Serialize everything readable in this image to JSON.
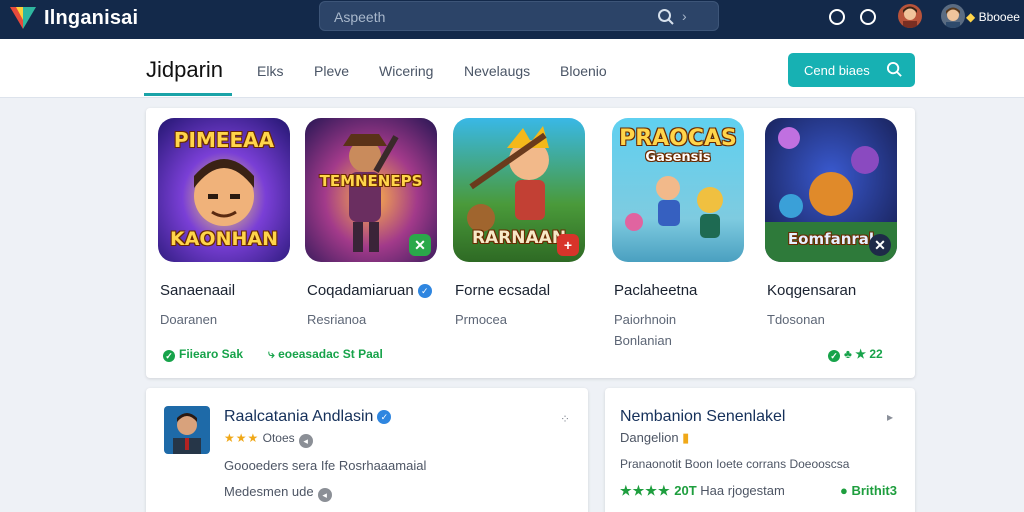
{
  "topbar": {
    "brand": "Ilnganisai",
    "search_placeholder": "Aspeeth",
    "search_chevron": "›",
    "badge_text": "Bbooee",
    "badge_icon": "◆"
  },
  "nav": {
    "title": "Jidparin",
    "tabs": [
      "Elks",
      "Pleve",
      "Wicering",
      "Nevelaugs",
      "Bloenio"
    ],
    "cta_label": "Cend biaes"
  },
  "games": [
    {
      "art_text": "PIMEEAA",
      "art_text2": "KAONHAN",
      "title": "Sanaenaail",
      "sub": "Doaranen",
      "sub2": "",
      "verified": false,
      "corner": ""
    },
    {
      "art_text": "TEMNENEPS",
      "art_text2": "",
      "title": "Coqadamiaruan",
      "sub": "Resrianoa",
      "sub2": "",
      "verified": true,
      "corner": "✕"
    },
    {
      "art_text": "RARNAAN",
      "art_text2": "",
      "title": "Forne ecsadal",
      "sub": "Prmocea",
      "sub2": "",
      "verified": false,
      "corner": "+"
    },
    {
      "art_text": "PRAOCAS",
      "art_text2": "Gasensis",
      "title": "Paclaheetna",
      "sub": "Paiorhnoin",
      "sub2": "Bonlanian",
      "verified": false,
      "corner": ""
    },
    {
      "art_text": "Eomfanral",
      "art_text2": "",
      "title": "Koqgensaran",
      "sub": "Tdosonan",
      "sub2": "",
      "verified": false,
      "corner": "✕"
    }
  ],
  "panel_footer": {
    "left_label": "Fiiearo Sak",
    "mid_label": "eoeasadac St Paal",
    "right_label": "22"
  },
  "bottom_left": {
    "title": "Raalcatania Andlasin",
    "rating_text": "Otoes",
    "line1": "Goooeders sera  Ife Rosrhaaamaial",
    "line2": "Medesmen ude"
  },
  "bottom_right": {
    "title": "Nembanion Senenlakel",
    "sub": "Dangelion",
    "line1": "Pranaonotit Boon  Ioete corrans Doeooscsa",
    "rating_num": "20T",
    "rating_label": "Haa rjogestam",
    "right_label": "Brithit3"
  },
  "colors": {
    "topbar": "#13294a",
    "accent": "#17b1b3",
    "link": "#15305a",
    "green": "#17a34a",
    "star": "#f0a818"
  }
}
